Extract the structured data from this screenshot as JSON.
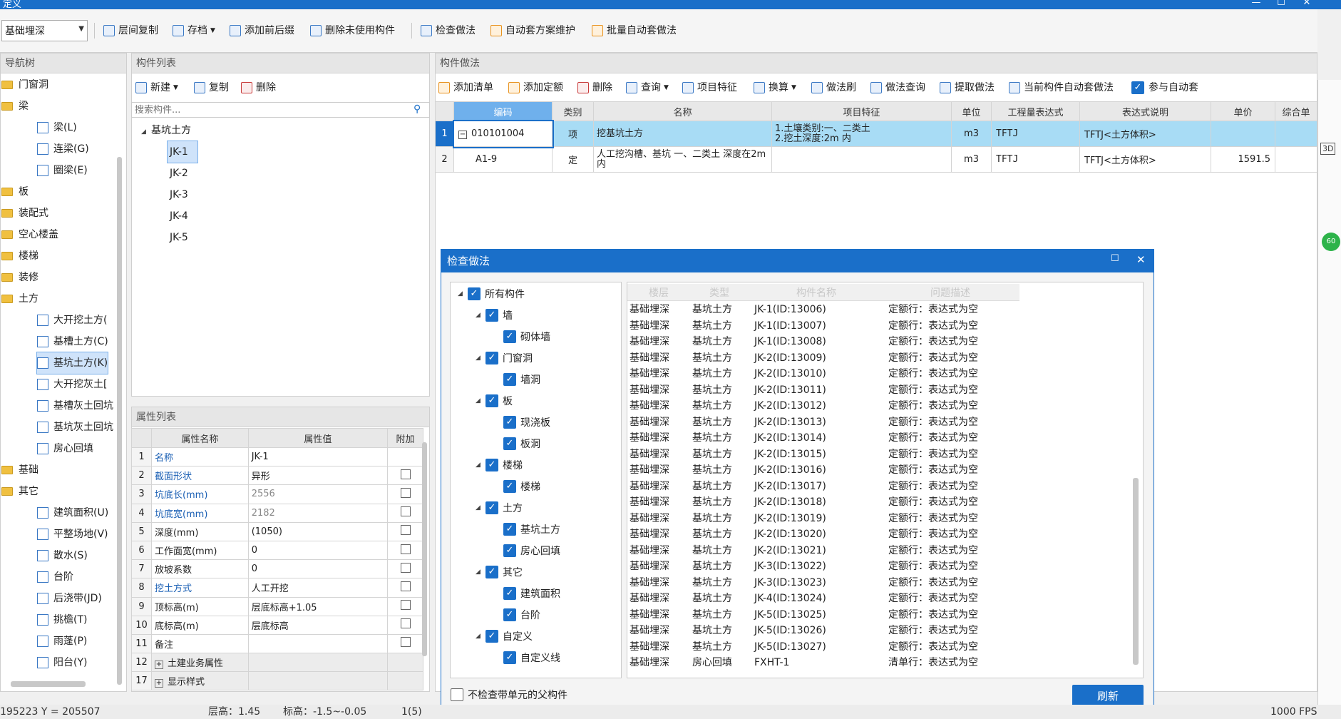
{
  "window": {
    "title": "定义",
    "minimize": "—",
    "maximize": "☐",
    "close": "✕"
  },
  "toolbar": {
    "floor_select": "基础埋深",
    "buttons": [
      "层间复制",
      "存档",
      "添加前后缀",
      "删除未使用构件",
      "检查做法",
      "自动套方案维护",
      "批量自动套做法"
    ]
  },
  "nav": {
    "header": "导航树",
    "items": [
      {
        "label": "门窗洞",
        "type": "folder"
      },
      {
        "label": "梁",
        "type": "folder"
      },
      {
        "label": "梁(L)",
        "type": "child"
      },
      {
        "label": "连梁(G)",
        "type": "child"
      },
      {
        "label": "圈梁(E)",
        "type": "child"
      },
      {
        "label": "板",
        "type": "folder"
      },
      {
        "label": "装配式",
        "type": "folder"
      },
      {
        "label": "空心楼盖",
        "type": "folder"
      },
      {
        "label": "楼梯",
        "type": "folder"
      },
      {
        "label": "装修",
        "type": "folder"
      },
      {
        "label": "土方",
        "type": "folder"
      },
      {
        "label": "大开挖土方(",
        "type": "child"
      },
      {
        "label": "基槽土方(C)",
        "type": "child"
      },
      {
        "label": "基坑土方(K)",
        "type": "child",
        "selected": true
      },
      {
        "label": "大开挖灰土[",
        "type": "child"
      },
      {
        "label": "基槽灰土回坑",
        "type": "child"
      },
      {
        "label": "基坑灰土回坑",
        "type": "child"
      },
      {
        "label": "房心回填",
        "type": "child"
      },
      {
        "label": "基础",
        "type": "folder"
      },
      {
        "label": "其它",
        "type": "folder"
      },
      {
        "label": "建筑面积(U)",
        "type": "child"
      },
      {
        "label": "平整场地(V)",
        "type": "child"
      },
      {
        "label": "散水(S)",
        "type": "child"
      },
      {
        "label": "台阶",
        "type": "child"
      },
      {
        "label": "后浇带(JD)",
        "type": "child"
      },
      {
        "label": "挑檐(T)",
        "type": "child"
      },
      {
        "label": "雨蓬(P)",
        "type": "child"
      },
      {
        "label": "阳台(Y)",
        "type": "child"
      }
    ]
  },
  "component_list": {
    "header": "构件列表",
    "new_label": "新建",
    "copy_label": "复制",
    "delete_label": "删除",
    "search_placeholder": "搜索构件...",
    "root": "基坑土方",
    "items": [
      "JK-1",
      "JK-2",
      "JK-3",
      "JK-4",
      "JK-5"
    ]
  },
  "properties": {
    "header": "属性列表",
    "columns": [
      "属性名称",
      "属性值",
      "附加"
    ],
    "rows": [
      {
        "no": "1",
        "name": "名称",
        "value": "JK-1",
        "blue": true,
        "check": false
      },
      {
        "no": "2",
        "name": "截面形状",
        "value": "异形",
        "blue": true,
        "check": true
      },
      {
        "no": "3",
        "name": "坑底长(mm)",
        "value": "2556",
        "blue": true,
        "gray": true,
        "check": true
      },
      {
        "no": "4",
        "name": "坑底宽(mm)",
        "value": "2182",
        "blue": true,
        "gray": true,
        "check": true
      },
      {
        "no": "5",
        "name": "深度(mm)",
        "value": "(1050)",
        "check": true
      },
      {
        "no": "6",
        "name": "工作面宽(mm)",
        "value": "0",
        "check": true
      },
      {
        "no": "7",
        "name": "放坡系数",
        "value": "0",
        "check": true
      },
      {
        "no": "8",
        "name": "挖土方式",
        "value": "人工开挖",
        "blue": true,
        "check": true
      },
      {
        "no": "9",
        "name": "顶标高(m)",
        "value": "层底标高+1.05",
        "check": true
      },
      {
        "no": "10",
        "name": "底标高(m)",
        "value": "层底标高",
        "check": true
      },
      {
        "no": "11",
        "name": "备注",
        "value": "",
        "check": true
      },
      {
        "no": "12",
        "name": "土建业务属性",
        "value": "",
        "expand": true
      },
      {
        "no": "17",
        "name": "显示样式",
        "value": "",
        "expand": true
      }
    ]
  },
  "method": {
    "header": "构件做法",
    "toolbar": [
      "添加清单",
      "添加定额",
      "删除",
      "查询",
      "项目特征",
      "换算",
      "做法刷",
      "做法查询",
      "提取做法",
      "当前构件自动套做法",
      "参与自动套"
    ],
    "columns": [
      "编码",
      "类别",
      "名称",
      "项目特征",
      "单位",
      "工程量表达式",
      "表达式说明",
      "单价",
      "综合单"
    ],
    "rows": [
      {
        "no": "1",
        "code": "010101004",
        "cat": "项",
        "name": "挖基坑土方",
        "feature1": "1.土壤类别:一、二类土",
        "feature2": "2.挖土深度:2m 内",
        "unit": "m3",
        "expr": "TFTJ",
        "desc": "TFTJ<土方体积>",
        "price": ""
      },
      {
        "no": "2",
        "code": "A1-9",
        "cat": "定",
        "name": "人工挖沟槽、基坑 一、二类土 深度在2m内",
        "feature1": "",
        "feature2": "",
        "unit": "m3",
        "expr": "TFTJ",
        "desc": "TFTJ<土方体积>",
        "price": "1591.5"
      }
    ]
  },
  "dialog": {
    "title": "检查做法",
    "tree": [
      {
        "label": "所有构件",
        "level": 0,
        "expand": true
      },
      {
        "label": "墙",
        "level": 1,
        "expand": true
      },
      {
        "label": "砌体墙",
        "level": 2
      },
      {
        "label": "门窗洞",
        "level": 1,
        "expand": true
      },
      {
        "label": "墙洞",
        "level": 2
      },
      {
        "label": "板",
        "level": 1,
        "expand": true
      },
      {
        "label": "现浇板",
        "level": 2
      },
      {
        "label": "板洞",
        "level": 2
      },
      {
        "label": "楼梯",
        "level": 1,
        "expand": true
      },
      {
        "label": "楼梯",
        "level": 2
      },
      {
        "label": "土方",
        "level": 1,
        "expand": true
      },
      {
        "label": "基坑土方",
        "level": 2
      },
      {
        "label": "房心回填",
        "level": 2
      },
      {
        "label": "其它",
        "level": 1,
        "expand": true
      },
      {
        "label": "建筑面积",
        "level": 2
      },
      {
        "label": "台阶",
        "level": 2
      },
      {
        "label": "自定义",
        "level": 1,
        "expand": true
      },
      {
        "label": "自定义线",
        "level": 2
      }
    ],
    "result_columns": [
      "楼层",
      "类型",
      "构件名称",
      "问题描述"
    ],
    "results": [
      [
        "基础埋深",
        "基坑土方",
        "JK-1(ID:13006)",
        "定额行：表达式为空"
      ],
      [
        "基础埋深",
        "基坑土方",
        "JK-1(ID:13007)",
        "定额行：表达式为空"
      ],
      [
        "基础埋深",
        "基坑土方",
        "JK-1(ID:13008)",
        "定额行：表达式为空"
      ],
      [
        "基础埋深",
        "基坑土方",
        "JK-2(ID:13009)",
        "定额行：表达式为空"
      ],
      [
        "基础埋深",
        "基坑土方",
        "JK-2(ID:13010)",
        "定额行：表达式为空"
      ],
      [
        "基础埋深",
        "基坑土方",
        "JK-2(ID:13011)",
        "定额行：表达式为空"
      ],
      [
        "基础埋深",
        "基坑土方",
        "JK-2(ID:13012)",
        "定额行：表达式为空"
      ],
      [
        "基础埋深",
        "基坑土方",
        "JK-2(ID:13013)",
        "定额行：表达式为空"
      ],
      [
        "基础埋深",
        "基坑土方",
        "JK-2(ID:13014)",
        "定额行：表达式为空"
      ],
      [
        "基础埋深",
        "基坑土方",
        "JK-2(ID:13015)",
        "定额行：表达式为空"
      ],
      [
        "基础埋深",
        "基坑土方",
        "JK-2(ID:13016)",
        "定额行：表达式为空"
      ],
      [
        "基础埋深",
        "基坑土方",
        "JK-2(ID:13017)",
        "定额行：表达式为空"
      ],
      [
        "基础埋深",
        "基坑土方",
        "JK-2(ID:13018)",
        "定额行：表达式为空"
      ],
      [
        "基础埋深",
        "基坑土方",
        "JK-2(ID:13019)",
        "定额行：表达式为空"
      ],
      [
        "基础埋深",
        "基坑土方",
        "JK-2(ID:13020)",
        "定额行：表达式为空"
      ],
      [
        "基础埋深",
        "基坑土方",
        "JK-2(ID:13021)",
        "定额行：表达式为空"
      ],
      [
        "基础埋深",
        "基坑土方",
        "JK-3(ID:13022)",
        "定额行：表达式为空"
      ],
      [
        "基础埋深",
        "基坑土方",
        "JK-3(ID:13023)",
        "定额行：表达式为空"
      ],
      [
        "基础埋深",
        "基坑土方",
        "JK-4(ID:13024)",
        "定额行：表达式为空"
      ],
      [
        "基础埋深",
        "基坑土方",
        "JK-5(ID:13025)",
        "定额行：表达式为空"
      ],
      [
        "基础埋深",
        "基坑土方",
        "JK-5(ID:13026)",
        "定额行：表达式为空"
      ],
      [
        "基础埋深",
        "基坑土方",
        "JK-5(ID:13027)",
        "定额行：表达式为空"
      ],
      [
        "基础埋深",
        "房心回填",
        "FXHT-1",
        "清单行：表达式为空"
      ]
    ],
    "skip_parent_label": "不检查带单元的父构件",
    "refresh_label": "刷新"
  },
  "status": {
    "coord": "195223 Y = 205507",
    "floor_height": "层高：1.45",
    "elevation": "标高：-1.5~-0.05",
    "page": "1(5)",
    "fps": "1000 FPS"
  },
  "right_badges": {
    "view3d": "3D",
    "zoom": "60"
  },
  "colors": {
    "accent": "#1a6fc9",
    "selected_row": "#a8dcf5",
    "header_gray": "#e6e6e6"
  }
}
